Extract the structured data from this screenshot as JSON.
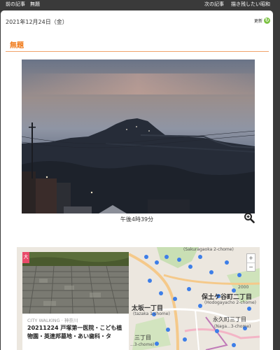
{
  "nav": {
    "prev": "前の記事",
    "category": "無題",
    "next": "次の記事",
    "blog": "描き残したい昭和"
  },
  "post": {
    "date": "2021年12月24日（金）",
    "update_label": "更新",
    "title": "無題",
    "caption": "午後4時39分"
  },
  "embed": {
    "category": "CITY WALKING · 神奈川",
    "headline": "20211224 戸塚第一医院・こども植物園・英連邦墓地・あい歯科・タ",
    "badge": "大",
    "map_labels": {
      "sakuragaoka": "(Sakuragaoka 2-chome)",
      "hodogaya_jp": "保土ケ谷町二丁目",
      "hodogaya_en": "(Hodogayacho 2-chome)",
      "otsuzaka_jp": "太坂一丁目",
      "otsuzaka_en": "(tazaka 1-chome)",
      "eikyucho_jp": "永久町三丁目",
      "eikyucho_en": "(Naga...3-chome)",
      "sanchome": "三丁目",
      "sanchome_en": "...3-chome)",
      "scale": "2000"
    },
    "zoom_in": "+",
    "zoom_out": "−"
  },
  "colors": {
    "accent": "#f07a1a",
    "update_icon": "#7cc242"
  }
}
